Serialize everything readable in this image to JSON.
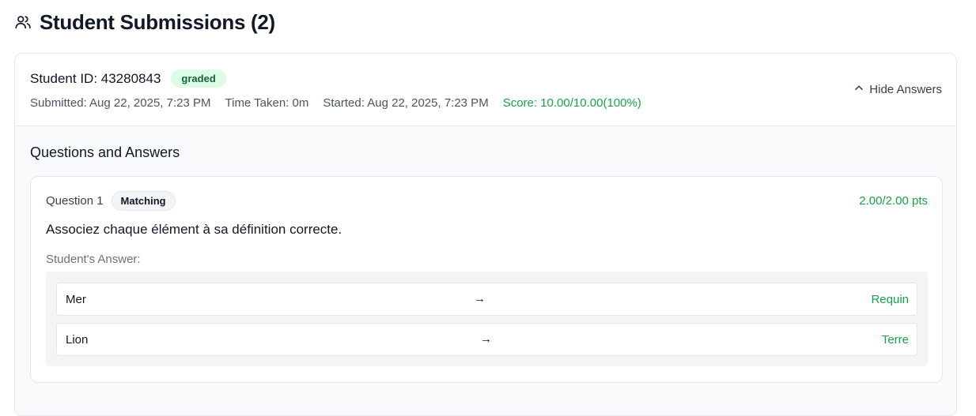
{
  "header": {
    "title": "Student Submissions (2)",
    "icon": "users-icon"
  },
  "submission": {
    "student_id": "Student ID: 43280843",
    "status_badge": "graded",
    "submitted": "Submitted: Aug 22, 2025, 7:23 PM",
    "time_taken": "Time Taken: 0m",
    "started": "Started: Aug 22, 2025, 7:23 PM",
    "score": "Score: 10.00/10.00(100%)",
    "toggle_label": "Hide Answers",
    "toggle_icon": "chevron-up-icon"
  },
  "qa": {
    "title": "Questions and Answers",
    "questions": [
      {
        "number": "Question 1",
        "type": "Matching",
        "points": "2.00/2.00 pts",
        "text": "Associez chaque élément à sa définition correcte.",
        "answer_label": "Student's Answer:",
        "pairs": [
          {
            "left": "Mer",
            "arrow": "→",
            "right": "Requin"
          },
          {
            "left": "Lion",
            "arrow": "→",
            "right": "Terre"
          }
        ]
      }
    ]
  },
  "colors": {
    "success": "#16a34a",
    "badge_bg": "#dcfce7",
    "border": "#e5e7eb",
    "panel_bg": "#f9fafb"
  }
}
